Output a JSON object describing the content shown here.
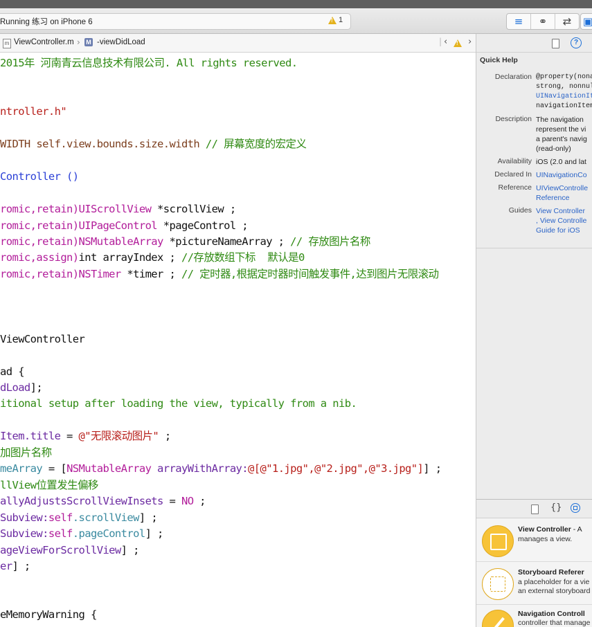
{
  "toolbar": {
    "activity_text": "Running 练习 on iPhone 6",
    "warning_count": "1",
    "editor_modes": [
      {
        "icon": "standard-editor-icon"
      },
      {
        "icon": "assistant-editor-icon"
      },
      {
        "icon": "version-editor-icon"
      }
    ],
    "view_toggle_icon": "navigator-toggle-icon"
  },
  "jumpbar": {
    "file_icon_letter": "m",
    "file": "ViewController.m",
    "method_icon_letter": "M",
    "method": "-viewDidLoad"
  },
  "colors": {
    "comment": "#2f8a13",
    "string": "#b8211c",
    "keyword": "#b21d9a",
    "class": "#6b2aa1",
    "macro": "#7c3e1d"
  },
  "code": {
    "lines": [
      [
        {
          "t": "2015年 河南青云信息技术有限公司. All rights reserved.",
          "c": "c-green"
        }
      ],
      [],
      [],
      [
        {
          "t": "ntroller.h\"",
          "c": "c-red"
        }
      ],
      [],
      [
        {
          "t": "WIDTH self.view.bounds.size.width ",
          "c": "c-brown"
        },
        {
          "t": "// 屏幕宽度的宏定义",
          "c": "c-green"
        }
      ],
      [],
      [
        {
          "t": "Controller ()",
          "c": "c-blue"
        }
      ],
      [],
      [
        {
          "t": "romic,retain)",
          "c": "c-purple"
        },
        {
          "t": "UIScrollView",
          "c": "c-purple"
        },
        {
          "t": " *scrollView ;",
          "c": "c-black"
        }
      ],
      [
        {
          "t": "romic,retain)",
          "c": "c-purple"
        },
        {
          "t": "UIPageControl",
          "c": "c-purple"
        },
        {
          "t": " *pageControl ;",
          "c": "c-black"
        }
      ],
      [
        {
          "t": "romic,retain)",
          "c": "c-purple"
        },
        {
          "t": "NSMutableArray",
          "c": "c-purple"
        },
        {
          "t": " *pictureNameArray ; ",
          "c": "c-black"
        },
        {
          "t": "// 存放图片名称",
          "c": "c-green"
        }
      ],
      [
        {
          "t": "romic,assign)",
          "c": "c-purple"
        },
        {
          "t": "int arrayIndex ; ",
          "c": "c-black"
        },
        {
          "t": "//存放数组下标  默认是0",
          "c": "c-green"
        }
      ],
      [
        {
          "t": "romic,retain)",
          "c": "c-purple"
        },
        {
          "t": "NSTimer",
          "c": "c-purple"
        },
        {
          "t": " *timer ; ",
          "c": "c-black"
        },
        {
          "t": "// 定时器,根据定时器时间触发事件,达到图片无限滚动",
          "c": "c-green"
        }
      ],
      [],
      [],
      [],
      [
        {
          "t": "ViewController",
          "c": "c-black"
        }
      ],
      [],
      [
        {
          "t": "ad {",
          "c": "c-black"
        }
      ],
      [
        {
          "t": "dLoad",
          "c": "c-violet"
        },
        {
          "t": "];",
          "c": "c-black"
        }
      ],
      [
        {
          "t": "itional setup after loading the view, typically from a nib.",
          "c": "c-green"
        }
      ],
      [],
      [
        {
          "t": "Item.title",
          "c": "c-violet"
        },
        {
          "t": " = ",
          "c": "c-black"
        },
        {
          "t": "@\"无限滚动图片\"",
          "c": "c-red"
        },
        {
          "t": " ;",
          "c": "c-black"
        }
      ],
      [
        {
          "t": "加图片名称",
          "c": "c-green"
        }
      ],
      [
        {
          "t": "meArray",
          "c": "c-teal"
        },
        {
          "t": " = [",
          "c": "c-black"
        },
        {
          "t": "NSMutableArray",
          "c": "c-purple"
        },
        {
          "t": " arrayWithArray:",
          "c": "c-violet"
        },
        {
          "t": "@[@\"1.jpg\",@\"2.jpg\",@\"3.jpg\"]",
          "c": "c-red"
        },
        {
          "t": "] ;",
          "c": "c-black"
        }
      ],
      [
        {
          "t": "llView位置发生偏移",
          "c": "c-green"
        }
      ],
      [
        {
          "t": "allyAdjustsScrollViewInsets",
          "c": "c-violet"
        },
        {
          "t": " = ",
          "c": "c-black"
        },
        {
          "t": "NO",
          "c": "c-purple"
        },
        {
          "t": " ;",
          "c": "c-black"
        }
      ],
      [
        {
          "t": "Subview:",
          "c": "c-violet"
        },
        {
          "t": "self",
          "c": "c-purple"
        },
        {
          "t": ".scrollView",
          "c": "c-teal"
        },
        {
          "t": "] ;",
          "c": "c-black"
        }
      ],
      [
        {
          "t": "Subview:",
          "c": "c-violet"
        },
        {
          "t": "self",
          "c": "c-purple"
        },
        {
          "t": ".pageControl",
          "c": "c-teal"
        },
        {
          "t": "] ;",
          "c": "c-black"
        }
      ],
      [
        {
          "t": "ageViewForScrollView",
          "c": "c-violet"
        },
        {
          "t": "] ;",
          "c": "c-black"
        }
      ],
      [
        {
          "t": "er",
          "c": "c-violet"
        },
        {
          "t": "] ;",
          "c": "c-black"
        }
      ],
      [],
      [],
      [
        {
          "t": "eMemoryWarning {",
          "c": "c-black"
        }
      ]
    ]
  },
  "inspector": {
    "tabs": [
      {
        "icon": "file-inspector-icon"
      },
      {
        "icon": "quick-help-icon"
      }
    ],
    "title": "Quick Help",
    "declaration_label": "Declaration",
    "declaration_lines": [
      "@property(nonat",
      "strong, nonnull)",
      "UINavigationItem",
      "navigationItem"
    ],
    "description_label": "Description",
    "description_lines": [
      "The navigation",
      "represent the vi",
      "a parent's navig",
      "(read-only)"
    ],
    "availability_label": "Availability",
    "availability": "iOS (2.0 and lat",
    "declared_in_label": "Declared In",
    "declared_in": "UINavigationCo",
    "reference_label": "Reference",
    "reference_lines": [
      "UIViewControlle",
      "Reference"
    ],
    "guides_label": "Guides",
    "guides_lines": [
      "View Controller",
      ", View Controlle",
      "Guide for iOS"
    ]
  },
  "library": {
    "tabs": [
      {
        "icon": "file-template-icon"
      },
      {
        "icon": "code-snippet-icon"
      },
      {
        "icon": "object-library-icon"
      }
    ],
    "items": [
      {
        "name": "View Controller",
        "name_suffix": " - A",
        "desc": "manages a view."
      },
      {
        "name": "Storyboard Referer",
        "name_suffix": "",
        "desc": "a placeholder for a vie",
        "desc2": "an external storyboard"
      },
      {
        "name": "Navigation Controll",
        "name_suffix": "",
        "desc": "controller that manage",
        "desc2": ""
      }
    ]
  }
}
